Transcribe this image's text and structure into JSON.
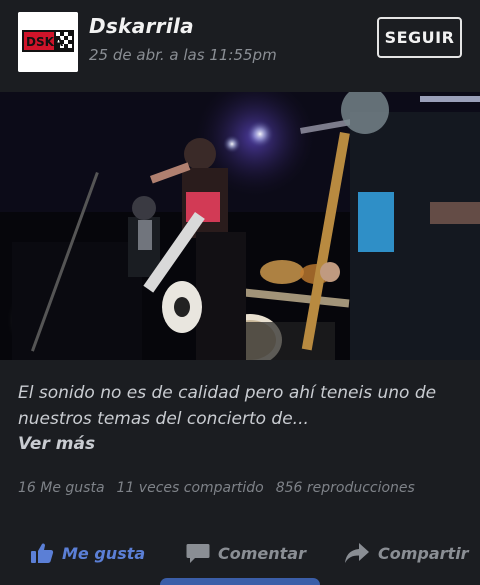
{
  "header": {
    "page_name": "Dskarrila",
    "timestamp": "25 de abr. a las 11:55pm",
    "follow_label": "SEGUIR",
    "logo_text": "DSKA"
  },
  "post": {
    "caption": "El sonido no es de calidad pero ahí teneis uno de nuestros temas del concierto de...",
    "see_more": "Ver más"
  },
  "stats": {
    "likes": "16 Me gusta",
    "shares": "11 veces compartido",
    "views": "856 reproducciones"
  },
  "actions": {
    "like_label": "Me gusta",
    "comment_label": "Comentar",
    "share_label": "Compartir"
  },
  "colors": {
    "background": "#1b1d21",
    "like_blue": "#5b7fd6",
    "muted": "#8a8e94"
  }
}
